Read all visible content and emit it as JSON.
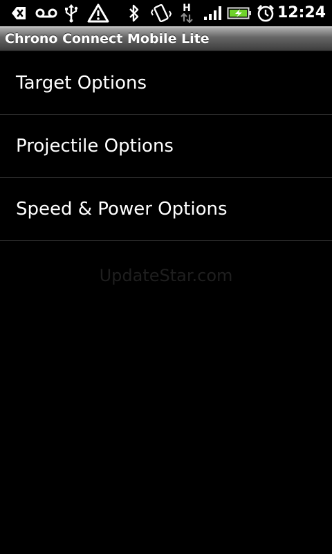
{
  "status_bar": {
    "icons": [
      "back-arrow-notification-icon",
      "voicemail-icon",
      "usb-icon",
      "warning-icon",
      "bluetooth-icon",
      "vibrate-icon",
      "hspa-data-icon",
      "signal-strength-icon",
      "battery-charging-icon",
      "alarm-clock-icon"
    ],
    "data_indicator": "H",
    "time": "12:24",
    "battery_color": "#6fd22b"
  },
  "app": {
    "title": "Chrono Connect Mobile Lite"
  },
  "menu": {
    "items": [
      {
        "label": "Target Options"
      },
      {
        "label": "Projectile Options"
      },
      {
        "label": "Speed & Power Options"
      }
    ]
  },
  "watermark": {
    "text": "UpdateStar.com"
  }
}
